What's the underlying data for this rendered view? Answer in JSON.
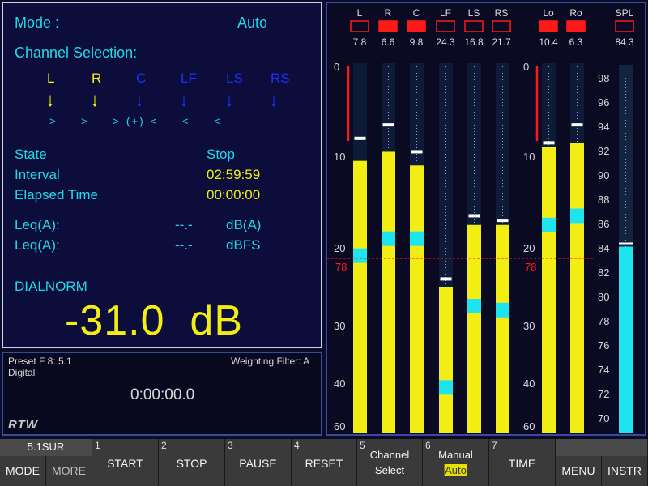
{
  "settings": {
    "mode_label": "Mode :",
    "mode_value": "Auto",
    "channel_selection_label": "Channel Selection:",
    "channels": [
      {
        "name": "L",
        "active": true
      },
      {
        "name": "R",
        "active": true
      },
      {
        "name": "C",
        "active": false
      },
      {
        "name": "LF",
        "active": false
      },
      {
        "name": "LS",
        "active": false
      },
      {
        "name": "RS",
        "active": false
      }
    ],
    "arrow_glyph": "↓",
    "mix_line": ">---->----> (+) <----<----<"
  },
  "status": {
    "state_label": "State",
    "state_value": "Stop",
    "interval_label": "Interval",
    "interval_value": "02:59:59",
    "elapsed_label": "Elapsed Time",
    "elapsed_value": "00:00:00"
  },
  "leq": [
    {
      "label": "Leq(A):",
      "value": "--.-",
      "unit": "dB(A)"
    },
    {
      "label": "Leq(A):",
      "value": "--.-",
      "unit": "dBFS"
    }
  ],
  "dialnorm": {
    "label": "DIALNORM",
    "value": "-31.0  dB"
  },
  "preset": {
    "preset_label": "Preset F 8: 5.1",
    "source": "Digital",
    "weighting": "Weighting Filter: A",
    "timer": "0:00:00.0",
    "logo": "RTW"
  },
  "meters": {
    "channels": [
      {
        "name": "L",
        "value": "7.8",
        "box_filled": false,
        "level_db": 10.5,
        "peak_db": 8.0,
        "cyan_db": 21.0
      },
      {
        "name": "R",
        "value": "6.6",
        "box_filled": true,
        "level_db": 9.5,
        "peak_db": 6.5,
        "cyan_db": 19.0
      },
      {
        "name": "C",
        "value": "9.8",
        "box_filled": true,
        "level_db": 11.0,
        "peak_db": 9.5,
        "cyan_db": 19.0
      },
      {
        "name": "LF",
        "value": "24.3",
        "box_filled": false,
        "level_db": 25.0,
        "peak_db": 24.0,
        "cyan_db": 42.0
      },
      {
        "name": "LS",
        "value": "16.8",
        "box_filled": false,
        "level_db": 17.5,
        "peak_db": 16.5,
        "cyan_db": 27.5
      },
      {
        "name": "RS",
        "value": "21.7",
        "box_filled": false,
        "level_db": 17.5,
        "peak_db": 17.0,
        "cyan_db": 28.0
      }
    ],
    "downmix": [
      {
        "name": "Lo",
        "value": "10.4",
        "box_filled": true,
        "level_db": 9.0,
        "peak_db": 8.5,
        "cyan_db": 17.5
      },
      {
        "name": "Ro",
        "value": "6.3",
        "box_filled": true,
        "level_db": 8.5,
        "peak_db": 6.5,
        "cyan_db": 16.5
      }
    ],
    "db_scale": [
      "0",
      "10",
      "20",
      "30",
      "40",
      "60"
    ],
    "reference_label": "78",
    "spl": {
      "name": "SPL",
      "value": "84.3",
      "box_filled": false,
      "level": 84.3,
      "scale": [
        "98",
        "96",
        "94",
        "92",
        "90",
        "88",
        "86",
        "84",
        "82",
        "80",
        "78",
        "76",
        "74",
        "72",
        "70"
      ]
    }
  },
  "softkeys": {
    "mode_display": "5.1SUR",
    "mode": "MODE",
    "more": "MORE",
    "buttons": [
      {
        "num": "1",
        "label": "START"
      },
      {
        "num": "2",
        "label": "STOP"
      },
      {
        "num": "3",
        "label": "PAUSE"
      },
      {
        "num": "4",
        "label": "RESET"
      },
      {
        "num": "5",
        "label": "Channel",
        "sublabel": "Select"
      },
      {
        "num": "6",
        "label": "Manual",
        "sublabel": "Auto"
      },
      {
        "num": "7",
        "label": "TIME"
      }
    ],
    "menu": "MENU",
    "instr": "INSTR"
  },
  "colors": {
    "meter_yellow": "#f2ee14",
    "meter_cyan": "#1ee4f0",
    "overload_red": "#ff1a1a",
    "text_cyan": "#22d8e8",
    "inactive_blue": "#1a30ff"
  }
}
